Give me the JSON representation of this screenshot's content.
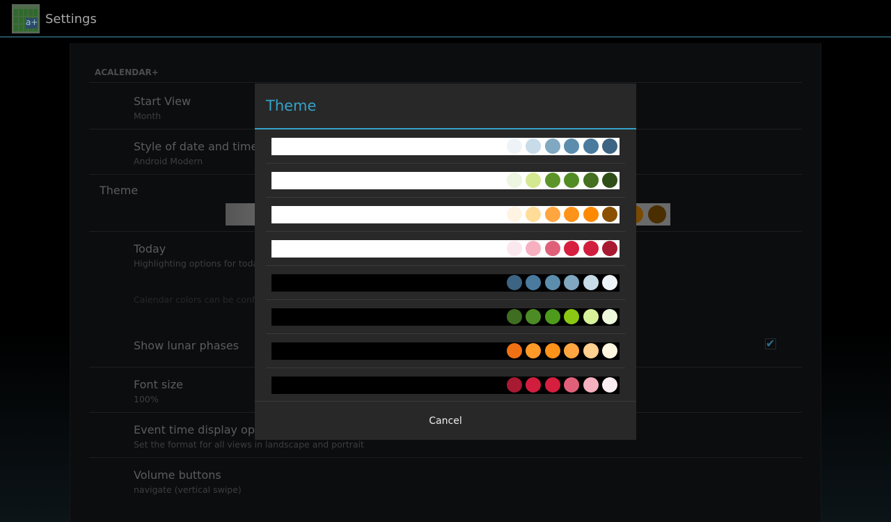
{
  "app": {
    "title": "Settings",
    "icon": "calendar-app-icon",
    "icon_letters": "a+"
  },
  "settings": {
    "category": "ACALENDAR+",
    "items": [
      {
        "title": "Start View",
        "summary": "Month"
      },
      {
        "title": "Style of date and time",
        "summary": "Android Modern"
      },
      {
        "title": "Theme"
      },
      {
        "title": "Today",
        "summary": "Highlighting options for today"
      },
      {
        "note": "Calendar colors can be configured"
      },
      {
        "title": "Show lunar phases",
        "checked": true
      },
      {
        "title": "Font size",
        "summary": "100%"
      },
      {
        "title": "Event time display options",
        "summary": "Set the format for all views in landscape and portrait"
      },
      {
        "title": "Volume buttons",
        "summary": "navigate (vertical swipe)"
      }
    ],
    "theme_preview_colors": [
      "#7a4a00",
      "#4a2e00"
    ]
  },
  "dialog": {
    "title": "Theme",
    "cancel_label": "Cancel",
    "accent": "#33a3c9",
    "themes": [
      {
        "bg": "#ffffff",
        "colors": [
          "#eef3f8",
          "#c8dbe8",
          "#80a8c0",
          "#5d8dad",
          "#4a7a9e",
          "#3d6482"
        ]
      },
      {
        "bg": "#ffffff",
        "colors": [
          "#eef5e0",
          "#d4e890",
          "#5d9429",
          "#528c25",
          "#447020",
          "#2f4d17"
        ]
      },
      {
        "bg": "#ffffff",
        "colors": [
          "#fff4e2",
          "#ffdd98",
          "#ffa640",
          "#ff9218",
          "#ff8a00",
          "#8a5000"
        ]
      },
      {
        "bg": "#ffffff",
        "colors": [
          "#fbe8ee",
          "#f6b0c0",
          "#e0607a",
          "#d61e3e",
          "#d21e3e",
          "#a81a32"
        ]
      },
      {
        "bg": "#000000",
        "colors": [
          "#3d6482",
          "#4a7a9e",
          "#5d8dad",
          "#80a8c0",
          "#c8dbe8",
          "#eef3f8"
        ]
      },
      {
        "bg": "#000000",
        "colors": [
          "#3f6e22",
          "#4d8c25",
          "#4e9a1c",
          "#8ac814",
          "#d8f29a",
          "#eef8dc"
        ]
      },
      {
        "bg": "#000000",
        "colors": [
          "#f07014",
          "#ff9a28",
          "#ff9218",
          "#ffa640",
          "#ffd090",
          "#fff6e0"
        ]
      },
      {
        "bg": "#000000",
        "colors": [
          "#a81a32",
          "#d21e3e",
          "#d61e3e",
          "#e0607a",
          "#f6b0c0",
          "#fbeef2"
        ]
      }
    ]
  }
}
